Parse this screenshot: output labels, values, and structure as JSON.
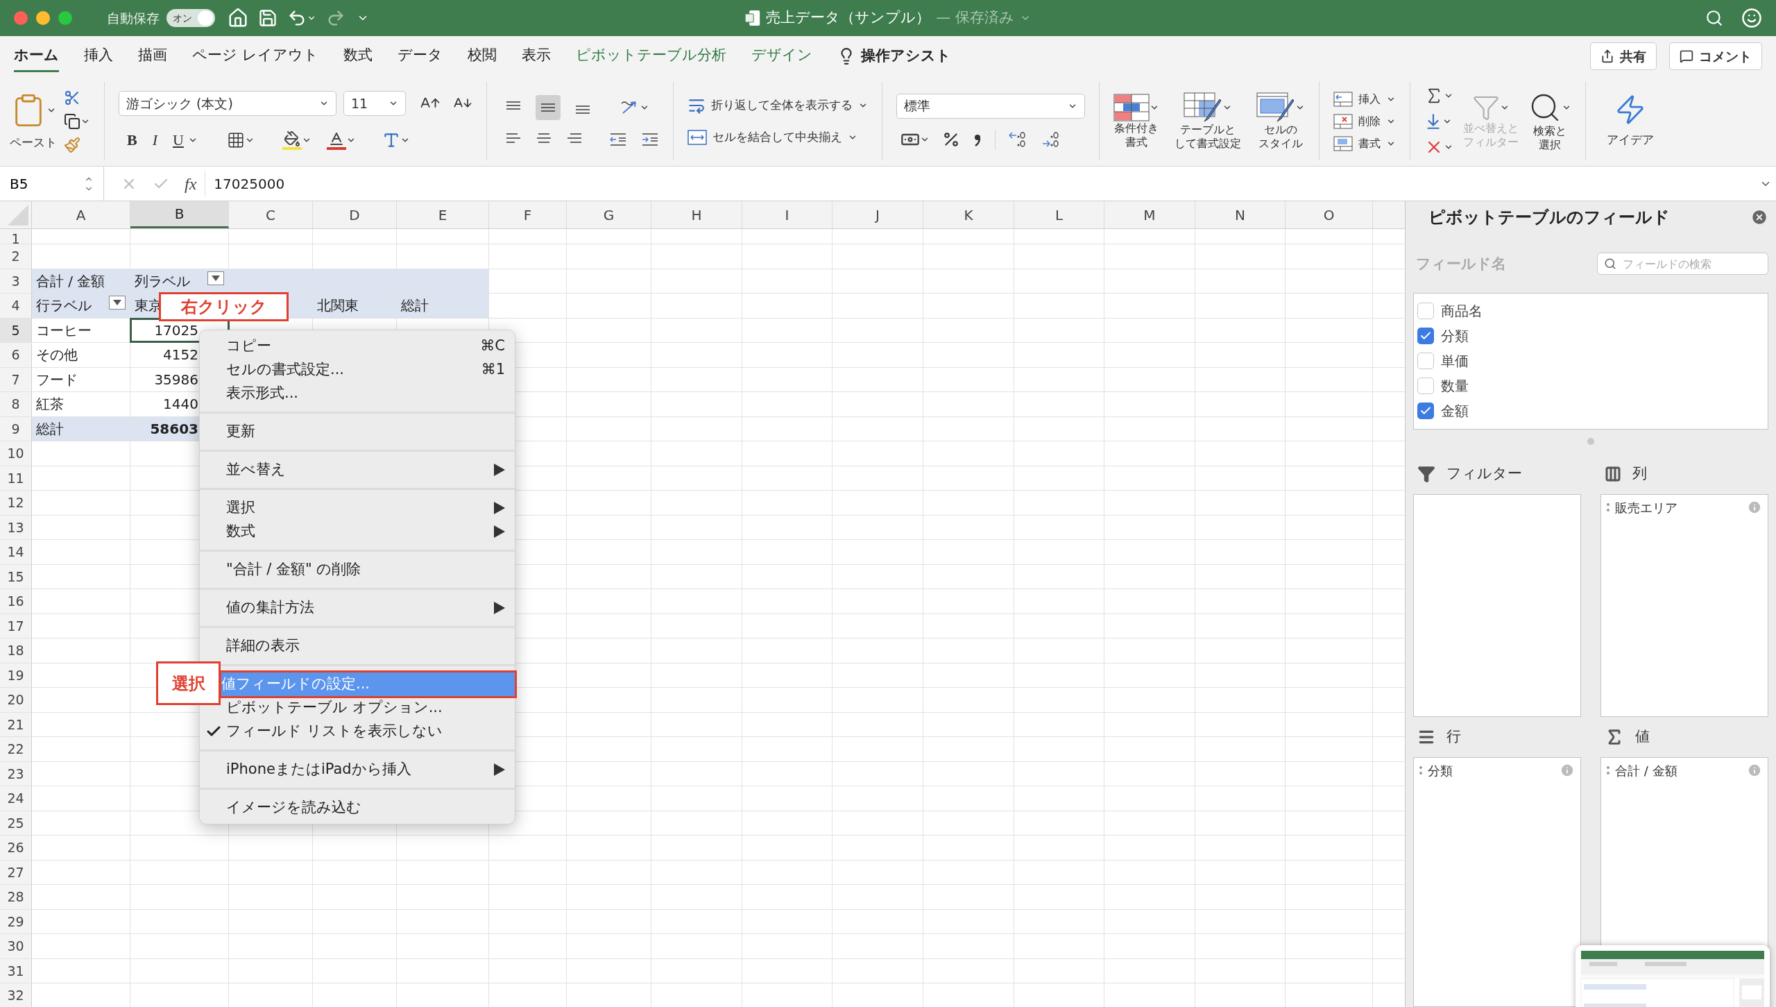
{
  "window": {
    "title": "売上データ（サンプル）",
    "status": "— 保存済み",
    "autosave_label": "自動保存",
    "autosave_toggle": {
      "label": "オン",
      "on": true
    }
  },
  "ribbon_tabs": [
    {
      "label": "ホーム",
      "selected": true,
      "kind": "normal"
    },
    {
      "label": "挿入",
      "selected": false,
      "kind": "normal"
    },
    {
      "label": "描画",
      "selected": false,
      "kind": "normal"
    },
    {
      "label": "ページ レイアウト",
      "selected": false,
      "kind": "normal"
    },
    {
      "label": "数式",
      "selected": false,
      "kind": "normal"
    },
    {
      "label": "データ",
      "selected": false,
      "kind": "normal"
    },
    {
      "label": "校閲",
      "selected": false,
      "kind": "normal"
    },
    {
      "label": "表示",
      "selected": false,
      "kind": "normal"
    },
    {
      "label": "ピボットテーブル分析",
      "selected": false,
      "kind": "context"
    },
    {
      "label": "デザイン",
      "selected": false,
      "kind": "context"
    }
  ],
  "tell_me": "操作アシスト",
  "share_button": "共有",
  "comment_button": "コメント",
  "ribbon": {
    "paste": "ペースト",
    "font_name": "游ゴシック (本文)",
    "font_size": "11",
    "font_style_buttons": [
      {
        "label": "B",
        "kind": "bold"
      },
      {
        "label": "I",
        "kind": "italic"
      },
      {
        "label": "U",
        "kind": "underline"
      }
    ],
    "vertical_align": [
      {
        "kind": "top",
        "selected": false
      },
      {
        "kind": "middle",
        "selected": true
      },
      {
        "kind": "bottom",
        "selected": false
      }
    ],
    "wrap_text": "折り返して全体を表示する",
    "merge": "セルを結合して中央揃え",
    "number_format": "標準",
    "style_buttons": [
      {
        "lines": [
          "条件付き",
          "書式"
        ],
        "kind": "conditional"
      },
      {
        "lines": [
          "テーブルと",
          "して書式設定"
        ],
        "kind": "table"
      },
      {
        "lines": [
          "セルの",
          "スタイル"
        ],
        "kind": "cell"
      }
    ],
    "cell_buttons": [
      {
        "label": "挿入",
        "kind": "insert"
      },
      {
        "label": "削除",
        "kind": "delete"
      },
      {
        "label": "書式",
        "kind": "format"
      }
    ],
    "sort_filter": {
      "lines": [
        "並べ替えと",
        "フィルター"
      ],
      "disabled": true
    },
    "find": {
      "lines": [
        "検索と",
        "選択"
      ]
    },
    "ideas": "アイデア"
  },
  "formula_bar": {
    "name_box": "B5",
    "function_label": "fx",
    "formula": "17025000"
  },
  "sheet": {
    "columns": [
      {
        "label": "A",
        "selected": false
      },
      {
        "label": "B",
        "selected": true
      },
      {
        "label": "C",
        "selected": false
      },
      {
        "label": "D",
        "selected": false
      },
      {
        "label": "E",
        "selected": false
      },
      {
        "label": "F",
        "selected": false
      },
      {
        "label": "G",
        "selected": false
      },
      {
        "label": "H",
        "selected": false
      },
      {
        "label": "I",
        "selected": false
      },
      {
        "label": "J",
        "selected": false
      },
      {
        "label": "K",
        "selected": false
      },
      {
        "label": "L",
        "selected": false
      },
      {
        "label": "M",
        "selected": false
      },
      {
        "label": "N",
        "selected": false
      },
      {
        "label": "O",
        "selected": false
      }
    ],
    "rows": [
      {
        "number": "1",
        "selected": false
      },
      {
        "number": "2",
        "selected": false
      },
      {
        "number": "3",
        "selected": false
      },
      {
        "number": "4",
        "selected": false
      },
      {
        "number": "5",
        "selected": true
      },
      {
        "number": "6",
        "selected": false
      },
      {
        "number": "7",
        "selected": false
      },
      {
        "number": "8",
        "selected": false
      },
      {
        "number": "9",
        "selected": false
      },
      {
        "number": "10",
        "selected": false
      },
      {
        "number": "11",
        "selected": false
      },
      {
        "number": "12",
        "selected": false
      },
      {
        "number": "13",
        "selected": false
      },
      {
        "number": "14",
        "selected": false
      },
      {
        "number": "15",
        "selected": false
      },
      {
        "number": "16",
        "selected": false
      },
      {
        "number": "17",
        "selected": false
      },
      {
        "number": "18",
        "selected": false
      },
      {
        "number": "19",
        "selected": false
      },
      {
        "number": "20",
        "selected": false
      },
      {
        "number": "21",
        "selected": false
      },
      {
        "number": "22",
        "selected": false
      },
      {
        "number": "23",
        "selected": false
      },
      {
        "number": "24",
        "selected": false
      },
      {
        "number": "25",
        "selected": false
      },
      {
        "number": "26",
        "selected": false
      },
      {
        "number": "27",
        "selected": false
      },
      {
        "number": "28",
        "selected": false
      },
      {
        "number": "29",
        "selected": false
      },
      {
        "number": "30",
        "selected": false
      },
      {
        "number": "31",
        "selected": false
      },
      {
        "number": "32",
        "selected": false
      }
    ],
    "pivot_rows": [
      {
        "kind": "header",
        "cells": [
          {
            "text": "合計 / 金額",
            "kind": "label"
          },
          {
            "text": "列ラベル",
            "kind": "label",
            "filter_button": true
          }
        ]
      },
      {
        "kind": "header",
        "cells": [
          {
            "text": "行ラベル",
            "kind": "label",
            "filter_button": true
          },
          {
            "text": "東京",
            "kind": "label"
          },
          {
            "kind": "empty"
          },
          {
            "text": "北関東",
            "kind": "label"
          },
          {
            "text": "総計",
            "kind": "label"
          }
        ]
      },
      {
        "kind": "body",
        "cells": [
          {
            "text": "コーヒー",
            "kind": "label"
          },
          {
            "text": "17025",
            "kind": "value",
            "selected": true
          }
        ]
      },
      {
        "kind": "body",
        "cells": [
          {
            "text": "その他",
            "kind": "label"
          },
          {
            "text": "4152",
            "kind": "value"
          }
        ]
      },
      {
        "kind": "body",
        "cells": [
          {
            "text": "フード",
            "kind": "label"
          },
          {
            "text": "35986",
            "kind": "value"
          }
        ]
      },
      {
        "kind": "body",
        "cells": [
          {
            "text": "紅茶",
            "kind": "label"
          },
          {
            "text": "1440",
            "kind": "value"
          }
        ]
      },
      {
        "kind": "total",
        "cells": [
          {
            "text": "総計",
            "kind": "label"
          },
          {
            "text": "58603",
            "kind": "value"
          }
        ]
      }
    ]
  },
  "context_menu": [
    {
      "kind": "item",
      "label": "コピー",
      "shortcut": "⌘C"
    },
    {
      "kind": "item",
      "label": "セルの書式設定...",
      "shortcut": "⌘1"
    },
    {
      "kind": "item",
      "label": "表示形式..."
    },
    {
      "kind": "separator"
    },
    {
      "kind": "item",
      "label": "更新"
    },
    {
      "kind": "separator"
    },
    {
      "kind": "item",
      "label": "並べ替え",
      "submenu": true
    },
    {
      "kind": "separator"
    },
    {
      "kind": "item",
      "label": "選択",
      "submenu": true
    },
    {
      "kind": "item",
      "label": "数式",
      "submenu": true
    },
    {
      "kind": "separator"
    },
    {
      "kind": "item",
      "label": "\"合計 / 金額\" の削除"
    },
    {
      "kind": "separator"
    },
    {
      "kind": "item",
      "label": "値の集計方法",
      "submenu": true
    },
    {
      "kind": "separator"
    },
    {
      "kind": "item",
      "label": "詳細の表示"
    },
    {
      "kind": "separator"
    },
    {
      "kind": "item",
      "label": "値フィールドの設定...",
      "selected": true
    },
    {
      "kind": "item",
      "label": "ピボットテーブル オプション..."
    },
    {
      "kind": "item",
      "label": "フィールド リストを表示しない",
      "checked": true
    },
    {
      "kind": "separator"
    },
    {
      "kind": "item",
      "label": "iPhoneまたはiPadから挿入",
      "submenu": true
    },
    {
      "kind": "separator"
    },
    {
      "kind": "item",
      "label": "イメージを読み込む"
    }
  ],
  "annotations": [
    {
      "text": "右クリック",
      "kind": "right_click"
    },
    {
      "text": "選択",
      "kind": "select"
    }
  ],
  "pivot_pane": {
    "title": "ピボットテーブルのフィールド",
    "field_name_label": "フィールド名",
    "search": {
      "placeholder": "フィールドの検索"
    },
    "fields": [
      {
        "label": "商品名",
        "checked": false
      },
      {
        "label": "分類",
        "checked": true
      },
      {
        "label": "単価",
        "checked": false
      },
      {
        "label": "数量",
        "checked": false
      },
      {
        "label": "金額",
        "checked": true
      }
    ],
    "areas": [
      {
        "title": "フィルター",
        "kind": "filter"
      },
      {
        "title": "列",
        "kind": "columns",
        "items": [
          "販売エリア"
        ]
      },
      {
        "title": "行",
        "kind": "rows",
        "items": [
          "分類"
        ]
      },
      {
        "title": "値",
        "kind": "values",
        "items": [
          "合計 / 金額"
        ]
      }
    ]
  }
}
